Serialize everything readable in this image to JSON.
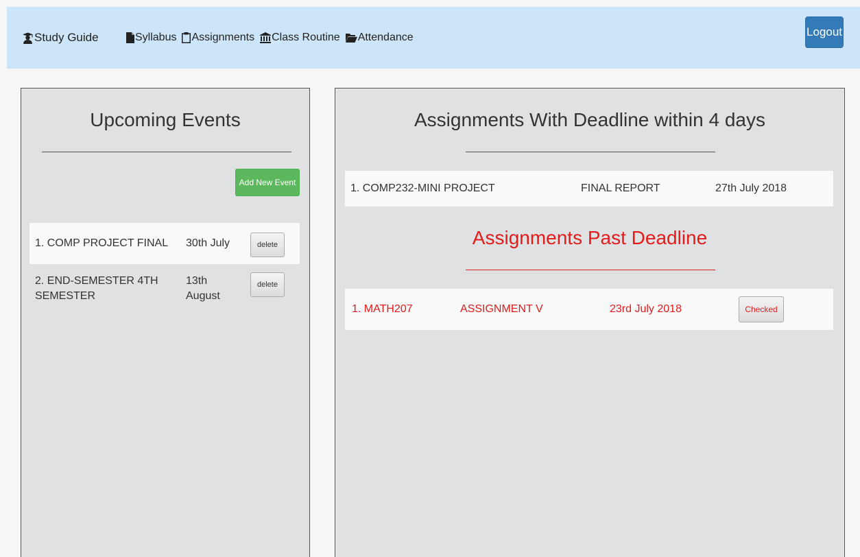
{
  "navbar": {
    "brand": "Study Guide",
    "links": [
      {
        "label": "Syllabus",
        "icon": "file-icon"
      },
      {
        "label": "Assignments",
        "icon": "clipboard-icon"
      },
      {
        "label": "Class Routine",
        "icon": "institution-icon"
      },
      {
        "label": "Attendance",
        "icon": "folder-open-icon"
      }
    ],
    "logout": "Logout"
  },
  "events": {
    "title": "Upcoming Events",
    "add_label": "Add New Event",
    "items": [
      {
        "name": "1. COMP PROJECT FINAL",
        "date": "30th July",
        "action": "delete"
      },
      {
        "name": "2. END-SEMESTER 4TH SEMESTER",
        "date": "13th August",
        "action": "delete"
      }
    ]
  },
  "assignments": {
    "title": "Assignments With Deadline within 4 days",
    "upcoming": [
      {
        "course": "1. COMP232-MINI PROJECT",
        "task": "FINAL REPORT",
        "date": "27th July 2018"
      }
    ],
    "past_title": "Assignments Past Deadline",
    "past": [
      {
        "course": "1. MATH207",
        "task": "ASSIGNMENT V",
        "date": "23rd July 2018",
        "action": "Checked"
      }
    ]
  },
  "colors": {
    "navbar_bg": "#cde5f8",
    "primary": "#337ab7",
    "success": "#5cb85c",
    "danger": "#e31b1b",
    "panel_bg": "#e0e1e2"
  }
}
